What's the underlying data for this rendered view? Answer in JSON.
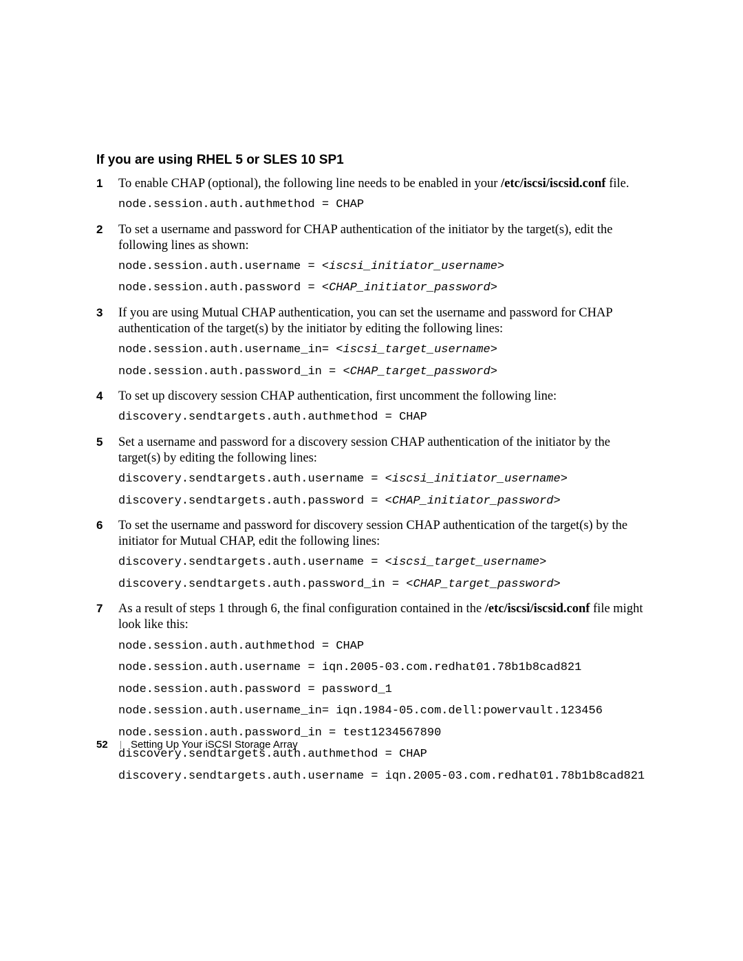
{
  "heading": "If you are using RHEL 5 or SLES 10 SP1",
  "steps": [
    {
      "text_before": "To enable CHAP (optional), the following line needs to be enabled in your ",
      "path": "/etc/iscsi/iscsid.conf",
      "text_after": " file.",
      "code": [
        {
          "plain": "node.session.auth.authmethod = CHAP"
        }
      ]
    },
    {
      "text_before": "To set a username and password for CHAP authentication of the initiator by the target(s), edit the following lines as shown:",
      "code": [
        {
          "plain": "node.session.auth.username = <",
          "ph": "iscsi_initiator_username",
          "tail": ">"
        },
        {
          "plain": "node.session.auth.password = <",
          "ph": "CHAP_initiator_password",
          "tail": ">"
        }
      ]
    },
    {
      "text_before": "If you are using Mutual CHAP authentication, you can set the username and password for CHAP authentication of the target(s) by the initiator by editing the following lines:",
      "code": [
        {
          "plain": "node.session.auth.username_in= <",
          "ph": "iscsi_target_username",
          "tail": ">"
        },
        {
          "plain": "node.session.auth.password_in = <",
          "ph": "CHAP_target_password",
          "tail": ">"
        }
      ]
    },
    {
      "text_before": "To set up discovery session CHAP authentication, first uncomment the following line:",
      "code": [
        {
          "plain": "discovery.sendtargets.auth.authmethod = CHAP"
        }
      ]
    },
    {
      "text_before": "Set a username and password for a discovery session CHAP authentication of the initiator by the target(s) by editing the following lines:",
      "code": [
        {
          "plain": "discovery.sendtargets.auth.username = <",
          "ph": "iscsi_initiator_username",
          "tail": ">"
        },
        {
          "plain": "discovery.sendtargets.auth.password = <",
          "ph": "CHAP_initiator_password",
          "tail": ">"
        }
      ]
    },
    {
      "text_before": "To set the username and password for discovery session CHAP authentication of the target(s) by the initiator for Mutual CHAP, edit the following lines:",
      "code": [
        {
          "plain": "discovery.sendtargets.auth.username = <",
          "ph": "iscsi_target_username",
          "tail": ">"
        },
        {
          "plain": "discovery.sendtargets.auth.password_in = <",
          "ph": "CHAP_target_password",
          "tail": ">"
        }
      ]
    },
    {
      "text_before": "As a result of steps 1 through 6, the final configuration contained in the ",
      "path": "/etc/iscsi/iscsid.conf",
      "text_after": " file might look like this:",
      "code": [
        {
          "plain": "node.session.auth.authmethod = CHAP"
        },
        {
          "plain": "node.session.auth.username = iqn.2005-03.com.redhat01.78b1b8cad821"
        },
        {
          "plain": "node.session.auth.password = password_1"
        },
        {
          "plain": "node.session.auth.username_in= iqn.1984-05.com.dell:powervault.123456"
        },
        {
          "plain": "node.session.auth.password_in = test1234567890"
        },
        {
          "plain": "discovery.sendtargets.auth.authmethod = CHAP"
        },
        {
          "plain": "discovery.sendtargets.auth.username = iqn.2005-03.com.redhat01.78b1b8cad821"
        }
      ]
    }
  ],
  "footer": {
    "page": "52",
    "title": "Setting Up Your iSCSI Storage Array"
  }
}
